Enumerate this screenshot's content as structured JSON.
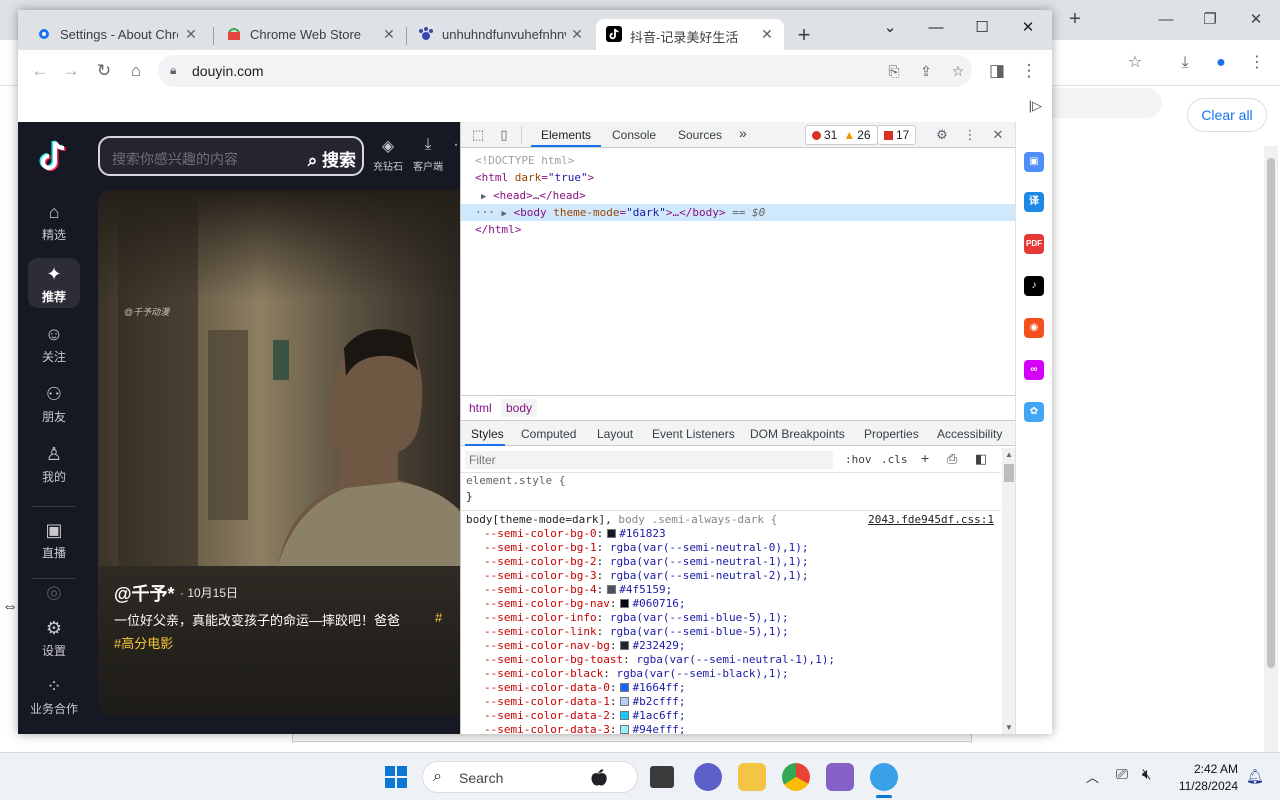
{
  "background_window": {
    "clear_all_label": "Clear all"
  },
  "tabs": [
    {
      "title": "Settings - About Chrom",
      "icon": "gear-icon"
    },
    {
      "title": "Chrome Web Store",
      "icon": "chrome-web-store-icon"
    },
    {
      "title": "unhuhndfunvuhefnhnvu",
      "icon": "paw-icon"
    },
    {
      "title": "抖音-记录美好生活",
      "icon": "tiktok-icon"
    }
  ],
  "address_bar": {
    "url": "douyin.com"
  },
  "douyin": {
    "search_placeholder": "搜索你感兴趣的内容",
    "search_button": "搜索",
    "header_actions": [
      {
        "label": "充钻石",
        "icon": "diamond-icon"
      },
      {
        "label": "客户端",
        "icon": "download-icon"
      }
    ],
    "sidebar": [
      {
        "label": "精选",
        "icon": "home-icon"
      },
      {
        "label": "推荐",
        "icon": "sparkle-icon"
      },
      {
        "label": "关注",
        "icon": "follow-icon"
      },
      {
        "label": "朋友",
        "icon": "friends-icon"
      },
      {
        "label": "我的",
        "icon": "user-icon"
      },
      {
        "label": "直播",
        "icon": "tv-icon"
      },
      {
        "label": "设置",
        "icon": "settings-icon"
      },
      {
        "label": "业务合作",
        "icon": "grid-icon"
      }
    ],
    "video": {
      "watermark": "@千予动漫",
      "author": "@千予*",
      "date": "· 10月15日",
      "description": "一位好父亲，真能改变孩子的命运—摔跤吧！爸爸",
      "tag1": "#",
      "tag2": "#高分电影"
    }
  },
  "devtools": {
    "tabs": [
      "Elements",
      "Console",
      "Sources"
    ],
    "more_tabs": "»",
    "errors": "31",
    "warnings": "26",
    "issues": "17",
    "dom": {
      "doctype": "<!DOCTYPE html>",
      "html_open_tag": "<html",
      "html_attr": "dark",
      "html_val": "\"true\"",
      "head": "<head>…</head>",
      "body_tag": "<body",
      "body_attr": "theme-mode",
      "body_val": "\"dark\"",
      "body_close": ">…</body>",
      "body_eq": "== $0",
      "html_close": "</html>"
    },
    "breadcrumbs": [
      "html",
      "body"
    ],
    "styles_tabs": [
      "Styles",
      "Computed",
      "Layout",
      "Event Listeners",
      "DOM Breakpoints",
      "Properties",
      "Accessibility"
    ],
    "filter_placeholder": "Filter",
    "hov": ":hov",
    "cls": ".cls",
    "element_style": "element.style {",
    "close_brace": "}",
    "rule_selector_a": "body[theme-mode=dark],",
    "rule_selector_b": "body .semi-always-dark {",
    "rule_source": "2043.fde945df.css:1",
    "declarations": [
      {
        "prop": "--semi-color-bg-0",
        "swatch": "#161823",
        "value": "#161823"
      },
      {
        "prop": "--semi-color-bg-1",
        "swatch": "",
        "value": "rgba(var(--semi-neutral-0),1);"
      },
      {
        "prop": "--semi-color-bg-2",
        "swatch": "",
        "value": "rgba(var(--semi-neutral-1),1);"
      },
      {
        "prop": "--semi-color-bg-3",
        "swatch": "",
        "value": "rgba(var(--semi-neutral-2),1);"
      },
      {
        "prop": "--semi-color-bg-4",
        "swatch": "#4f5159",
        "value": "#4f5159;"
      },
      {
        "prop": "--semi-color-bg-nav",
        "swatch": "#060716",
        "value": "#060716;"
      },
      {
        "prop": "--semi-color-info",
        "swatch": "",
        "value": "rgba(var(--semi-blue-5),1);"
      },
      {
        "prop": "--semi-color-link",
        "swatch": "",
        "value": "rgba(var(--semi-blue-5),1);"
      },
      {
        "prop": "--semi-color-nav-bg",
        "swatch": "#232429",
        "value": "#232429;"
      },
      {
        "prop": "--semi-color-bg-toast",
        "swatch": "",
        "value": "rgba(var(--semi-neutral-1),1);"
      },
      {
        "prop": "--semi-color-black",
        "swatch": "",
        "value": "rgba(var(--semi-black),1);"
      },
      {
        "prop": "--semi-color-data-0",
        "swatch": "#1664ff",
        "value": "#1664ff;"
      },
      {
        "prop": "--semi-color-data-1",
        "swatch": "#b2cfff",
        "value": "#b2cfff;"
      },
      {
        "prop": "--semi-color-data-2",
        "swatch": "#1ac6ff",
        "value": "#1ac6ff;"
      },
      {
        "prop": "--semi-color-data-3",
        "swatch": "#94efff",
        "value": "#94efff;"
      }
    ]
  },
  "taskbar": {
    "search_label": "Search",
    "time": "2:42 AM",
    "date": "11/28/2024"
  }
}
